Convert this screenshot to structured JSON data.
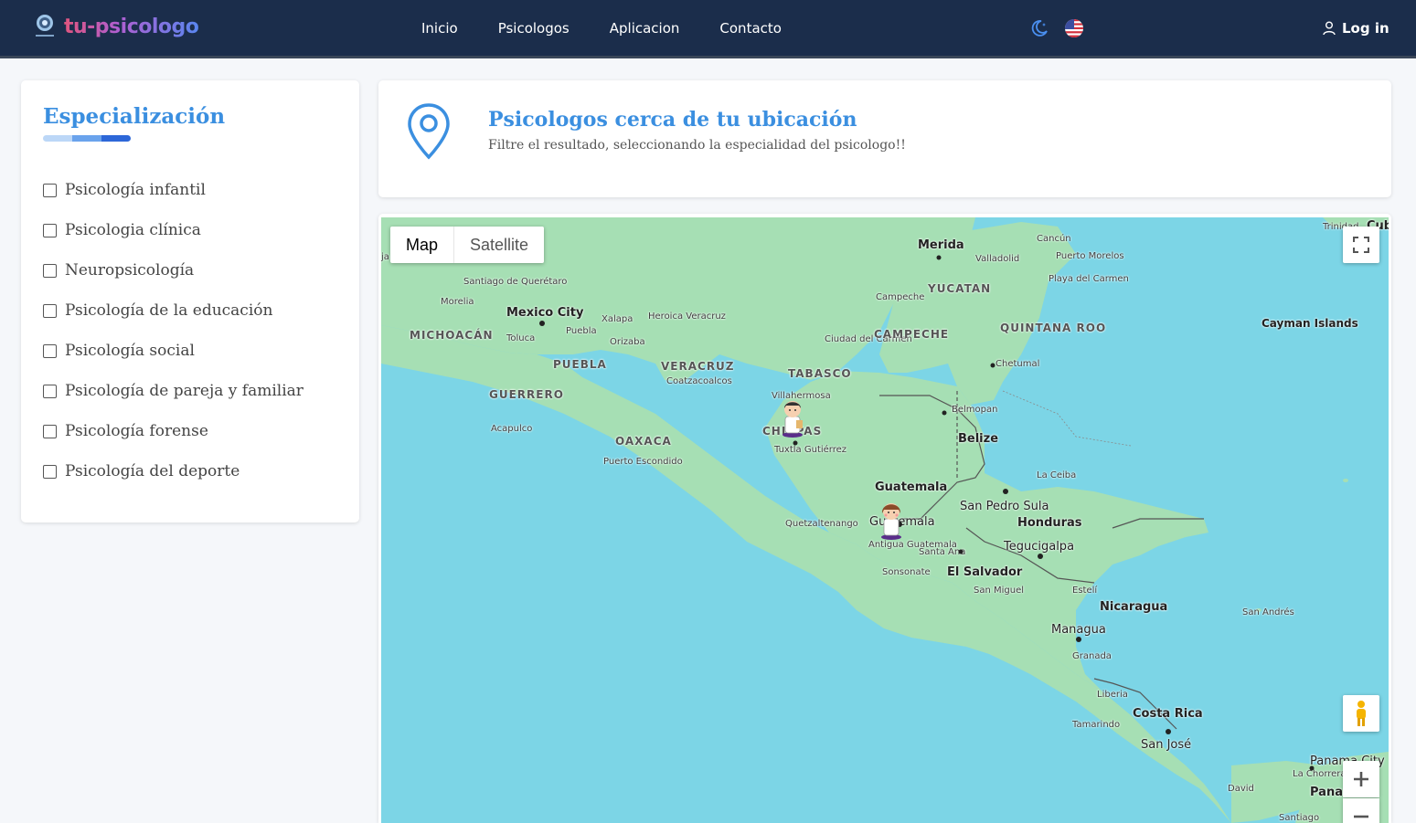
{
  "brand": {
    "name": "tu-psicologo"
  },
  "nav": {
    "links": [
      "Inicio",
      "Psicologos",
      "Aplicacion",
      "Contacto"
    ],
    "login": "Log in",
    "icons": {
      "theme": "moon-icon",
      "language": "us-flag-icon",
      "user": "user-icon"
    }
  },
  "sidebar": {
    "title": "Especialización",
    "filters": [
      "Psicología infantil",
      "Psicologia clínica",
      "Neuropsicología",
      "Psicología de la educación",
      "Psicología social",
      "Psicología de pareja y familiar",
      "Psicología forense",
      "Psicología del deporte"
    ],
    "checked": [
      false,
      false,
      false,
      false,
      false,
      false,
      false,
      false
    ]
  },
  "header": {
    "title": "Psicologos cerca de tu ubicación",
    "subtitle": "Filtre el resultado, seleccionando la especialidad del psicologo!!"
  },
  "map": {
    "type_map": "Map",
    "type_satellite": "Satellite",
    "labels": {
      "merida": "Merida",
      "cancun": "Cancún",
      "valladolid": "Valladolid",
      "puerto_morelos": "Puerto Morelos",
      "playa": "Playa del Carmen",
      "yucatan": "YUCATAN",
      "campeche_city": "Campeche",
      "queretaro": "Santiago de Querétaro",
      "morelia": "Morelia",
      "mexico_city": "Mexico City",
      "xalapa": "Xalapa",
      "heroica": "Heroica Veracruz",
      "puebla_city": "Puebla",
      "toluca": "Toluca",
      "orizaba": "Orizaba",
      "michoacan": "MICHOACÁN",
      "puebla": "PUEBLA",
      "veracruz": "VERACRUZ",
      "coatzacoalcos": "Coatzacoalcos",
      "tabasco": "TABASCO",
      "ciudad_carmen": "Ciudad del Carmen",
      "campeche": "CAMPECHE",
      "quintana": "QUINTANA ROO",
      "chetumal": "Chetumal",
      "cayman": "Cayman Islands",
      "guerrero": "GUERRERO",
      "villahermosa": "Villahermosa",
      "belmopan": "Belmopan",
      "belize": "Belize",
      "acapulco": "Acapulco",
      "oaxaca": "OAXACA",
      "chiapas": "CHIAPAS",
      "tuxtla": "Tuxtla Gutiérrez",
      "puerto_escondido": "Puerto Escondido",
      "guatemala": "Guatemala",
      "la_ceiba": "La Ceiba",
      "san_pedro": "San Pedro Sula",
      "honduras": "Honduras",
      "quetzaltenango": "Quetzaltenango",
      "guatemala_city": "Guatemala",
      "antigua": "Antigua Guatemala",
      "santa_ana": "Santa Ana",
      "tegucigalpa": "Tegucigalpa",
      "sonsonate": "Sonsonate",
      "el_salvador": "El Salvador",
      "san_miguel": "San Miguel",
      "esteli": "Estelí",
      "nicaragua": "Nicaragua",
      "san_andres": "San Andrés",
      "managua": "Managua",
      "granada": "Granada",
      "liberia": "Liberia",
      "costa_rica": "Costa Rica",
      "tamarindo": "Tamarindo",
      "san_jose": "San José",
      "panama": "Panama City",
      "la_chorrera": "La Chorrera",
      "panama_short": "Pana",
      "david": "David",
      "santiago": "Santiago",
      "trinidad": "Trinidad",
      "cuba": "Cub",
      "ja": "ja"
    },
    "controls": [
      "fullscreen-icon",
      "pegman-icon",
      "zoom-in-icon",
      "zoom-out-icon"
    ]
  },
  "colors": {
    "navbar": "#1b2d4b",
    "accent": "#3b8fe0",
    "water": "#7cd5e6",
    "land": "#a6dfb4"
  }
}
